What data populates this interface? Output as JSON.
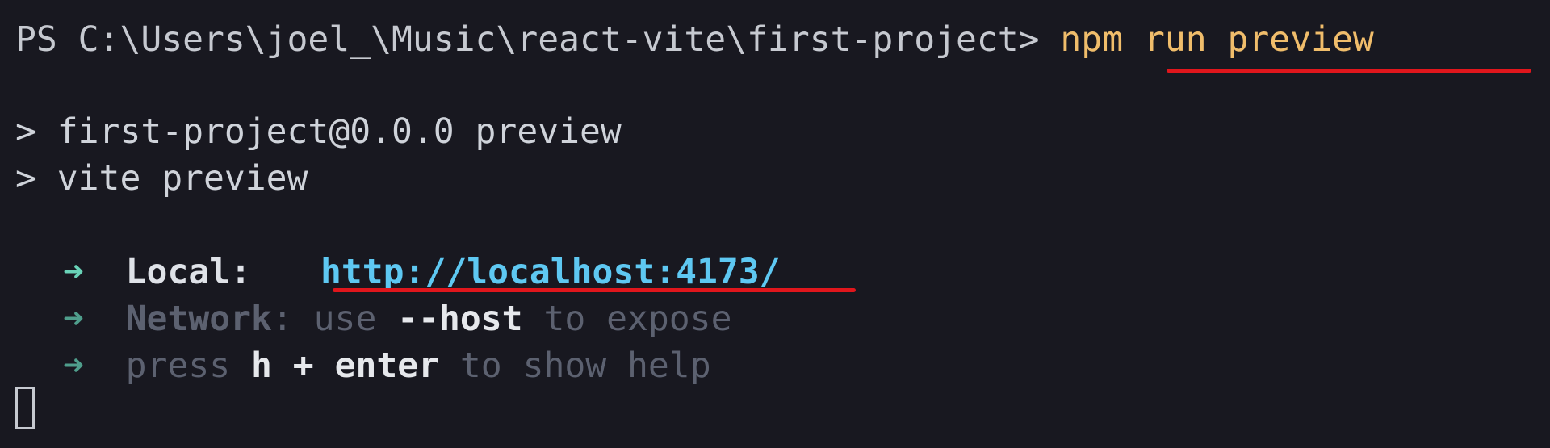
{
  "terminal": {
    "prompt": "PS C:\\Users\\joel_\\Music\\react-vite\\first-project> ",
    "command": "npm run preview",
    "script_line_1": "> first-project@0.0.0 preview",
    "script_line_2": "> vite preview",
    "local": {
      "arrow": "➜",
      "label": "Local:",
      "url": "http://localhost:4173/"
    },
    "network": {
      "arrow": "➜",
      "label": "Network",
      "text_1": ": use ",
      "flag": "--host",
      "text_2": " to expose"
    },
    "help": {
      "arrow": "➜",
      "text_1": "press ",
      "key_h": "h",
      "plus": " + ",
      "key_enter": "enter",
      "text_2": " to show help"
    }
  },
  "colors": {
    "background": "#181820",
    "command": "#f0bd6b",
    "url": "#5ec8f2",
    "arrow": "#69d3b8",
    "annotation_underline": "#e0161c"
  }
}
